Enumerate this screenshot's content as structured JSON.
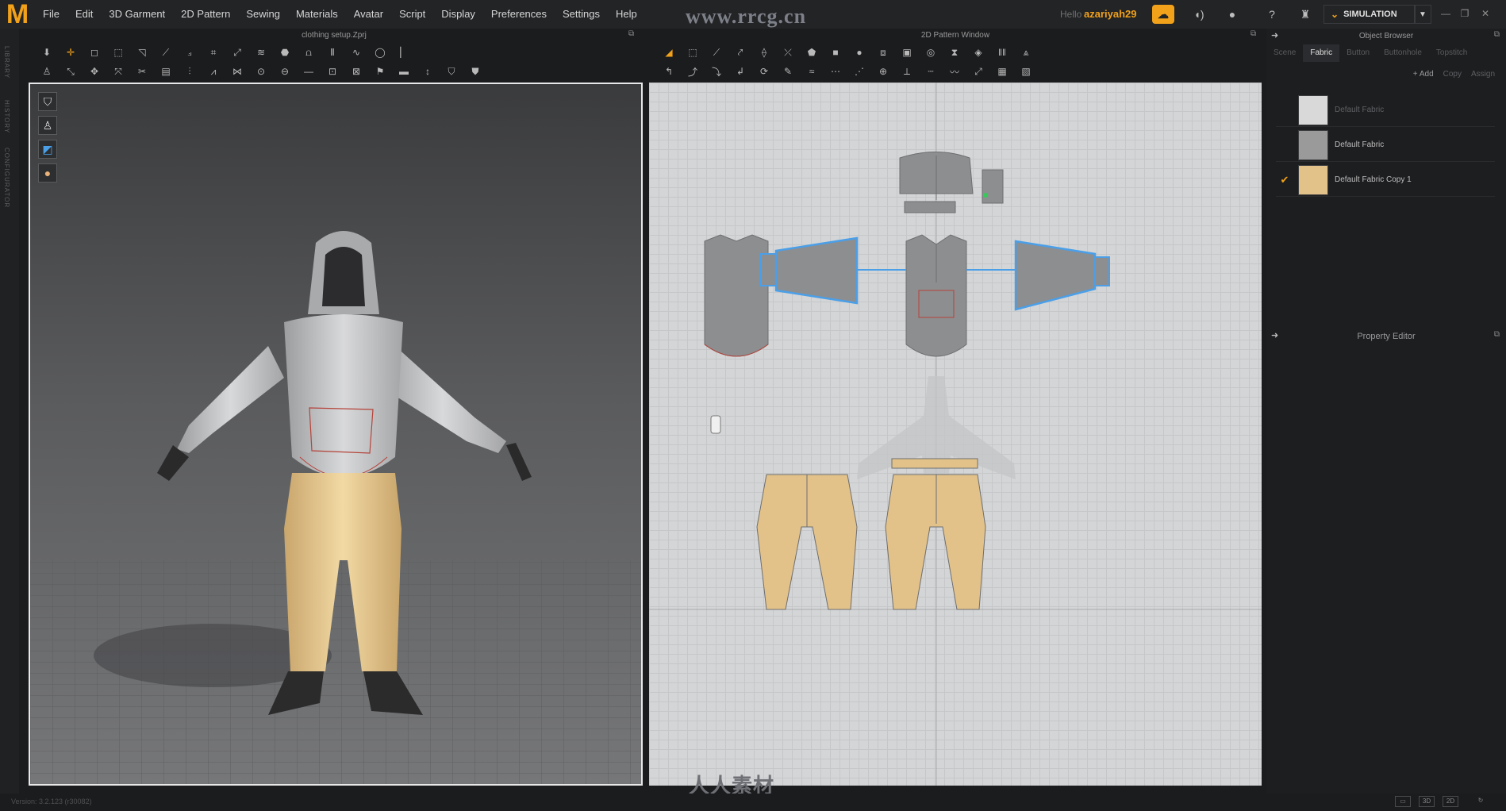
{
  "app": {
    "logo": "M",
    "file_name": "clothing setup.Zprj"
  },
  "menu": [
    "File",
    "Edit",
    "3D Garment",
    "2D Pattern",
    "Sewing",
    "Materials",
    "Avatar",
    "Script",
    "Display",
    "Preferences",
    "Settings",
    "Help"
  ],
  "watermark": {
    "site": "www.rrcg.cn",
    "bottom_brand": "人人素材"
  },
  "user": {
    "hello": "Hello",
    "name": "azariyah29"
  },
  "mode": {
    "label": "SIMULATION"
  },
  "left_strip": [
    "LIBRARY",
    "HISTORY",
    "CONFIGURATOR"
  ],
  "viewport3d": {
    "title": "clothing setup.Zprj"
  },
  "pattern_window": {
    "title": "2D Pattern Window"
  },
  "object_browser": {
    "title": "Object Browser",
    "tabs": [
      "Scene",
      "Fabric",
      "Button",
      "Buttonhole",
      "Topstitch"
    ],
    "active_tab": "Fabric",
    "actions": [
      "+ Add",
      "Copy",
      "Assign"
    ],
    "fabrics": [
      {
        "name": "Default Fabric",
        "color": "#d9d9d9",
        "selected": false,
        "dim": true
      },
      {
        "name": "Default Fabric",
        "color": "#9a9a9a",
        "selected": false,
        "dim": false
      },
      {
        "name": "Default Fabric Copy 1",
        "color": "#e3c28a",
        "selected": true,
        "dim": false
      }
    ]
  },
  "property_editor": {
    "title": "Property Editor"
  },
  "status": {
    "version": "Version: 3.2.123    (r30082)"
  },
  "colors": {
    "accent": "#f2a21a",
    "pants": "#e3c28a",
    "selection": "#4a9fe8",
    "pattern_gray": "#8d8e90"
  }
}
